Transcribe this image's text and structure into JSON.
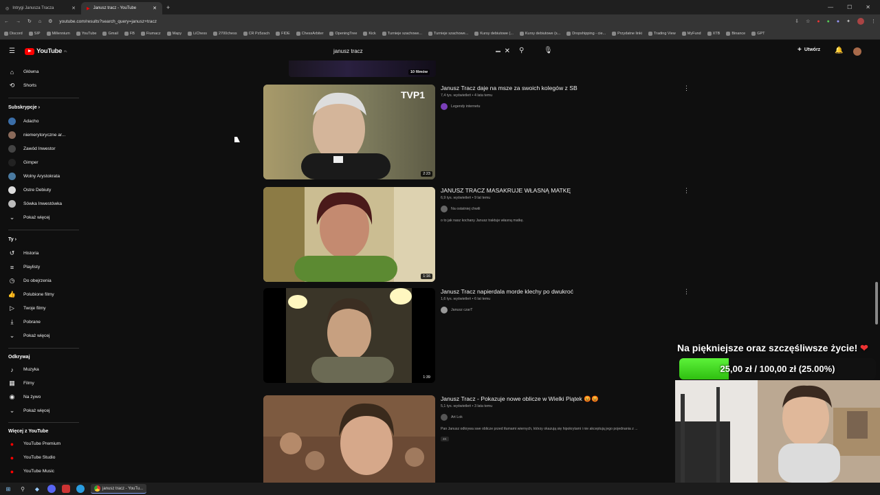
{
  "browser": {
    "tabs": [
      {
        "label": "Intrygi Janusza Tracza",
        "active": false
      },
      {
        "label": "Janusz tracz - YouTube",
        "active": true
      }
    ],
    "url": "youtube.com/results?search_query=janusz+tracz",
    "bookmarks": [
      "Discord",
      "SIP",
      "Millennium",
      "YouTube",
      "Gmail",
      "FB",
      "Fiumacz",
      "Mapy",
      "LiChess",
      "2700chess",
      "CR Pz5zach",
      "FIDE",
      "ChessArbiter",
      "OpeningTree",
      "Kick",
      "Turnieje szachowe...",
      "Turnieje szachowe...",
      "Kursy debiutowe (...",
      "Kursy debiutowe (s...",
      "Dropshipping - cie...",
      "Przydatne linki",
      "Trading View",
      "MyFund",
      "XTB",
      "Binance",
      "GPT"
    ]
  },
  "youtube": {
    "logo_text": "YouTube",
    "logo_region": "PL",
    "search_value": "janusz tracz",
    "create_label": "Utwórz"
  },
  "sidebar": {
    "main": [
      {
        "label": "Główna",
        "icon": "home-icon"
      },
      {
        "label": "Shorts",
        "icon": "shorts-icon"
      }
    ],
    "subs_heading": "Subskrypcje",
    "subs": [
      "Adacho",
      "niemerytoryczne ar...",
      "Zawód Inwestor",
      "Gimper",
      "Wolny Arystokrata",
      "Ostre Debiuty",
      "Sówka Inwestówka"
    ],
    "show_more": "Pokaż więcej",
    "you_heading": "Ty",
    "you": [
      {
        "label": "Historia",
        "icon": "history-icon"
      },
      {
        "label": "Playlisty",
        "icon": "playlist-icon"
      },
      {
        "label": "Do obejrzenia",
        "icon": "clock-icon"
      },
      {
        "label": "Polubione filmy",
        "icon": "thumb-up-icon"
      },
      {
        "label": "Twoje filmy",
        "icon": "video-icon"
      },
      {
        "label": "Pobrane",
        "icon": "download-icon"
      },
      {
        "label": "Pokaż więcej",
        "icon": "chevron-down-icon"
      }
    ],
    "explore_heading": "Odkrywaj",
    "explore": [
      {
        "label": "Muzyka",
        "icon": "music-icon"
      },
      {
        "label": "Filmy",
        "icon": "film-icon"
      },
      {
        "label": "Na żywo",
        "icon": "live-icon"
      },
      {
        "label": "Pokaż więcej",
        "icon": "chevron-down-icon"
      }
    ],
    "more_heading": "Więcej z YouTube",
    "more": [
      {
        "label": "YouTube Premium"
      },
      {
        "label": "YouTube Studio"
      },
      {
        "label": "YouTube Music"
      }
    ]
  },
  "playlist_count": "10 filmów",
  "results": [
    {
      "title": "Janusz Tracz daje na msze za swoich kolegów z SB",
      "meta": "7,4 tys. wyświetleń • 4 lata temu",
      "channel": "Legendy internetu",
      "desc": "",
      "duration": "2:23",
      "channel_color": "#7a3fb8"
    },
    {
      "title": "JANUSZ TRACZ MASAKRUJE WŁASNĄ MATKĘ",
      "meta": "6,9 tys. wyświetleń • 9 lat temu",
      "channel": "Na ostatniej chwili",
      "desc": "o to jak nasz kochany Janusz traktuje własną matkę.",
      "duration": "1:16",
      "channel_color": "#666"
    },
    {
      "title": "Janusz Tracz napierdala morde klechy po dwukroć",
      "meta": "1,6 tys. wyświetleń • 6 lat temu",
      "channel": "Janusz czarT",
      "desc": "",
      "duration": "1:39",
      "channel_color": "#999"
    },
    {
      "title": "Janusz Tracz - Pokazuje nowe oblicze w Wielki Piątek 😡😡",
      "meta": "5,1 tys. wyświetleń • 3 lata temu",
      "channel": "Art Lok",
      "desc": "Pan Janusz odkrywa swe oblicze przed tłumami wiernych, którzy okazują się hipokrytami i nie akceptują jego pojednania z ...",
      "duration": "",
      "badge": "4K",
      "channel_color": "#555"
    }
  ],
  "overlay": {
    "title": "Na piękniejsze oraz szczęśliwsze życie!",
    "progress_text": "25,00 zł / 100,00 zł (25.00%)",
    "progress_fraction": 0.25
  },
  "taskbar": {
    "active_app": "janusz tracz - YouTu..."
  }
}
